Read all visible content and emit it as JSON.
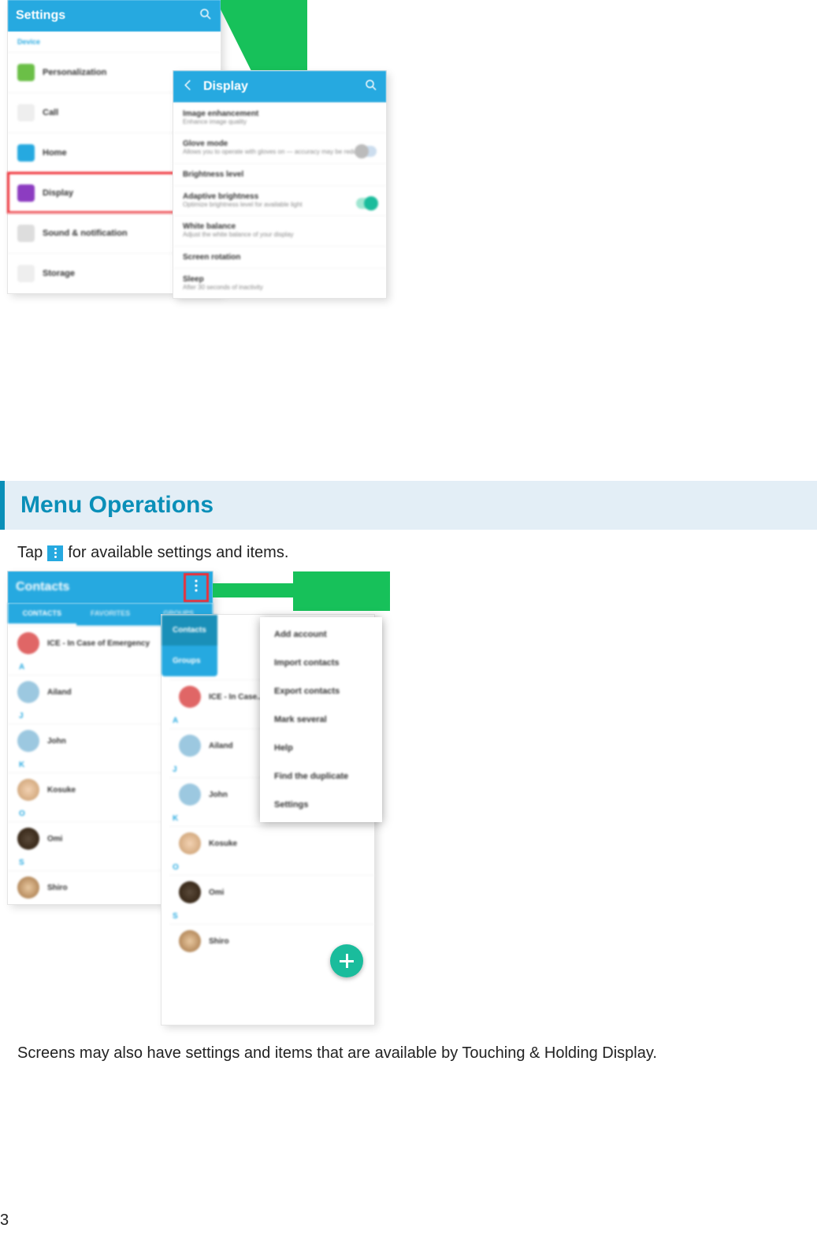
{
  "page_number": "3",
  "heading": "Menu Operations",
  "para1_a": "Tap",
  "para1_b": "for available settings and items.",
  "para2": "Screens may also have settings and items that are available by Touching & Holding Display.",
  "settings_screen": {
    "title": "Settings",
    "section": "Device",
    "items": [
      {
        "label": "Personalization",
        "icon_color": "#6bbf47"
      },
      {
        "label": "Call",
        "icon_color": "#cfcfcf"
      },
      {
        "label": "Home",
        "icon_color": "#26a9e0"
      },
      {
        "label": "Display",
        "icon_color": "#8c3cc1",
        "highlight": true
      },
      {
        "label": "Sound & notification",
        "icon_color": "#bdbdbd"
      },
      {
        "label": "Storage",
        "icon_color": "#cfcfcf"
      }
    ]
  },
  "display_screen": {
    "title": "Display",
    "items": [
      {
        "t": "Image enhancement",
        "s": "Enhance image quality"
      },
      {
        "t": "Glove mode",
        "s": "Allows you to operate with gloves on — accuracy may be reduced",
        "toggle": "off"
      },
      {
        "t": "Brightness level",
        "s": ""
      },
      {
        "t": "Adaptive brightness",
        "s": "Optimize brightness level for available light",
        "toggle": "on"
      },
      {
        "t": "White balance",
        "s": "Adjust the white balance of your display"
      },
      {
        "t": "Screen rotation",
        "s": ""
      },
      {
        "t": "Sleep",
        "s": "After 30 seconds of inactivity"
      }
    ]
  },
  "contacts_screen": {
    "title": "Contacts",
    "tabs": [
      "CONTACTS",
      "FAVORITES",
      "GROUPS"
    ],
    "active_tab": 0,
    "rows": [
      {
        "letter": "",
        "name": "ICE - In Case of Emergency",
        "avatar": "#e06666"
      },
      {
        "letter": "A",
        "name": "Ailand",
        "avatar": "#5aa9d6"
      },
      {
        "letter": "J",
        "name": "John",
        "avatar": "#5aa9d6"
      },
      {
        "letter": "K",
        "name": "Kosuke",
        "avatar": "photo1"
      },
      {
        "letter": "O",
        "name": "Omi",
        "avatar": "photo2"
      },
      {
        "letter": "S",
        "name": "Shiro",
        "avatar": "photo3"
      }
    ]
  },
  "contacts_screen_bg": {
    "rows": [
      {
        "name": "ICE - In Case...",
        "avatar": "#e06666"
      },
      {
        "name": "Ailand",
        "avatar": "#5aa9d6"
      },
      {
        "name": "John",
        "avatar": "#5aa9d6"
      },
      {
        "name": "Kosuke",
        "avatar": "photo1"
      },
      {
        "name": "Omi",
        "avatar": "photo2"
      },
      {
        "name": "Shiro",
        "avatar": "photo3"
      }
    ]
  },
  "side_tabs": [
    "Contacts",
    "Groups"
  ],
  "overflow_menu": [
    "Add account",
    "Import contacts",
    "Export contacts",
    "Mark several",
    "Help",
    "Find the duplicate",
    "Settings"
  ]
}
